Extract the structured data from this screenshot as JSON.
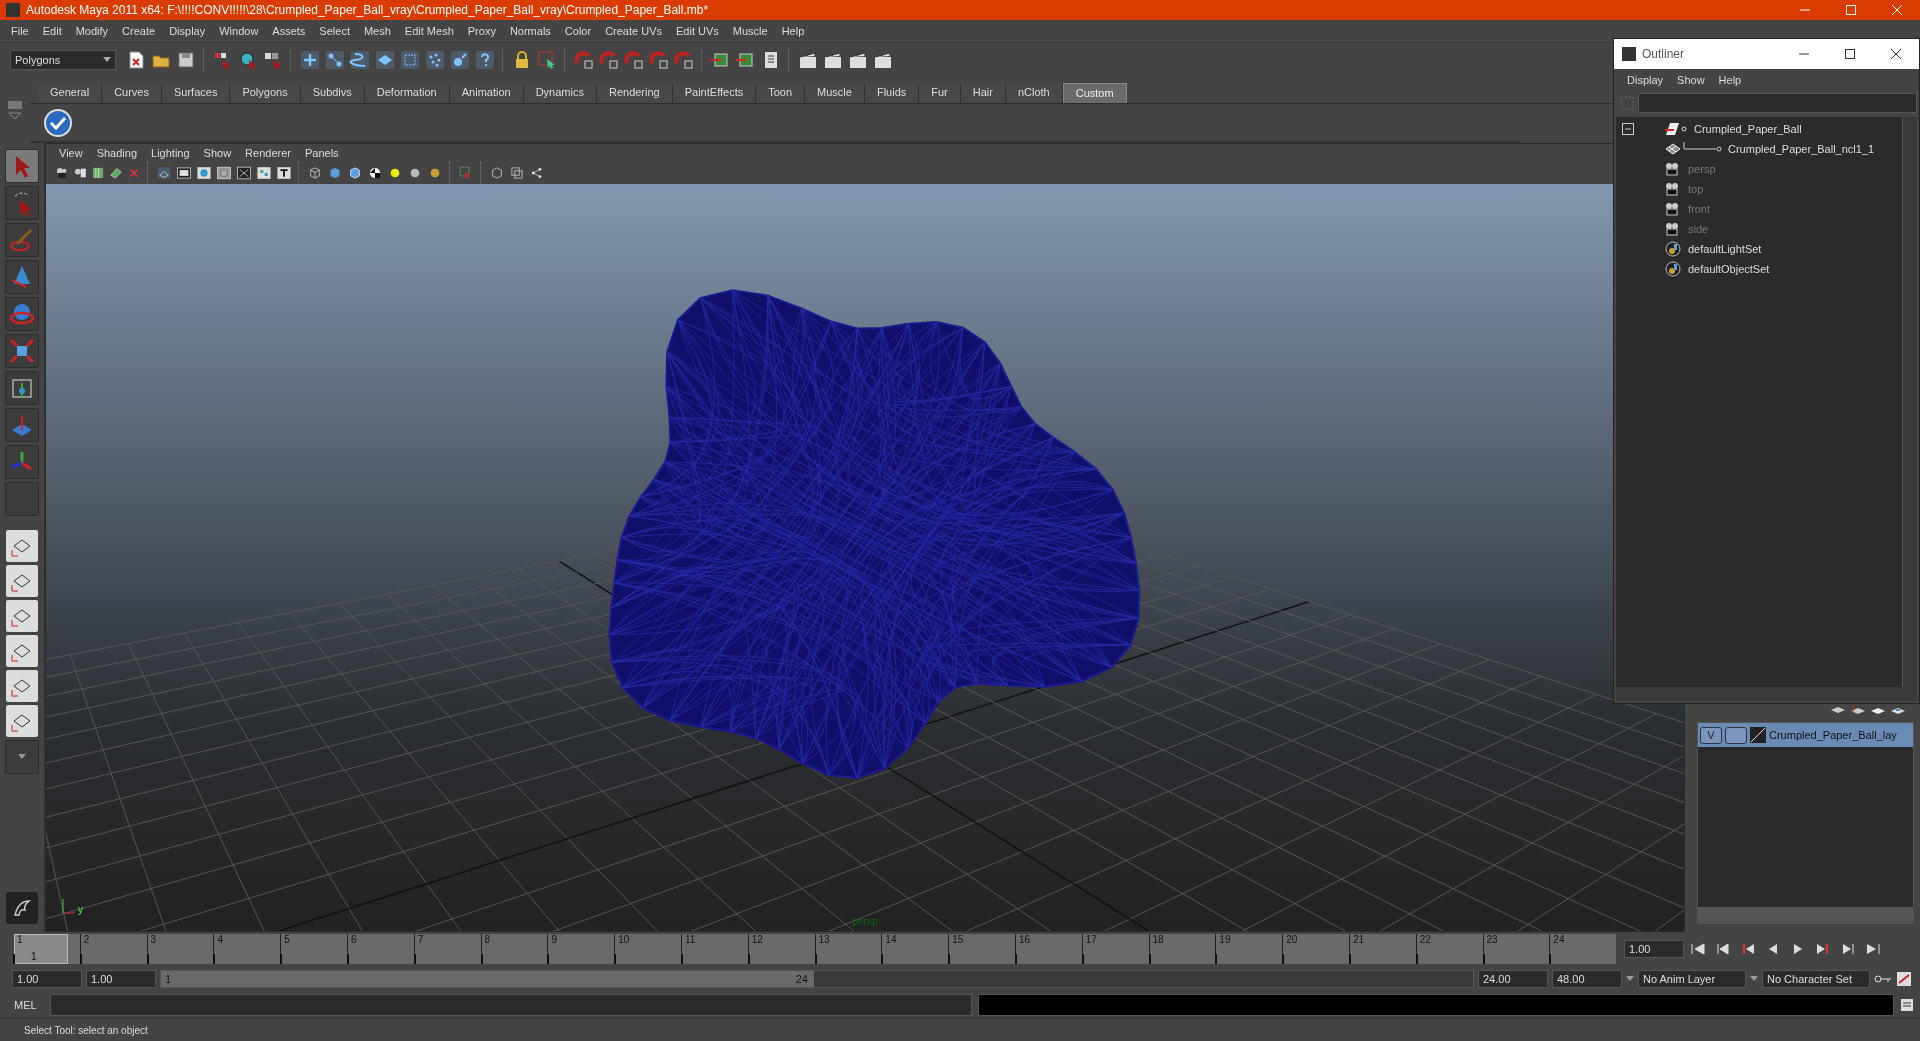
{
  "window": {
    "title": "Autodesk Maya 2011 x64: F:\\!!!!CONV!!!!!\\28\\Crumpled_Paper_Ball_vray\\Crumpled_Paper_Ball_vray\\Crumpled_Paper_Ball.mb*"
  },
  "menu_bar": [
    "File",
    "Edit",
    "Modify",
    "Create",
    "Display",
    "Window",
    "Assets",
    "Select",
    "Mesh",
    "Edit Mesh",
    "Proxy",
    "Normals",
    "Color",
    "Create UVs",
    "Edit UVs",
    "Muscle",
    "Help"
  ],
  "toolbar": {
    "mode_dropdown": "Polygons"
  },
  "shelf": {
    "tabs": [
      {
        "label": "General",
        "selected": false
      },
      {
        "label": "Curves",
        "selected": false
      },
      {
        "label": "Surfaces",
        "selected": false
      },
      {
        "label": "Polygons",
        "selected": false
      },
      {
        "label": "Subdivs",
        "selected": false
      },
      {
        "label": "Deformation",
        "selected": false
      },
      {
        "label": "Animation",
        "selected": false
      },
      {
        "label": "Dynamics",
        "selected": false
      },
      {
        "label": "Rendering",
        "selected": false
      },
      {
        "label": "PaintEffects",
        "selected": false
      },
      {
        "label": "Toon",
        "selected": false
      },
      {
        "label": "Muscle",
        "selected": false
      },
      {
        "label": "Fluids",
        "selected": false
      },
      {
        "label": "Fur",
        "selected": false
      },
      {
        "label": "Hair",
        "selected": false
      },
      {
        "label": "nCloth",
        "selected": false
      },
      {
        "label": "Custom",
        "selected": true
      }
    ]
  },
  "viewport": {
    "menu": [
      "View",
      "Shading",
      "Lighting",
      "Show",
      "Renderer",
      "Panels"
    ],
    "camera_label": "persp",
    "axis_label": "y"
  },
  "outliner": {
    "title": "Outliner",
    "menu": [
      "Display",
      "Show",
      "Help"
    ],
    "items": [
      {
        "label": "Crumpled_Paper_Ball",
        "kind": "transform",
        "dimmed": false,
        "expanded": true,
        "children": [
          {
            "label": "Crumpled_Paper_Ball_ncl1_1",
            "kind": "mesh",
            "dimmed": false
          }
        ]
      },
      {
        "label": "persp",
        "kind": "camera",
        "dimmed": true
      },
      {
        "label": "top",
        "kind": "camera",
        "dimmed": true
      },
      {
        "label": "front",
        "kind": "camera",
        "dimmed": true
      },
      {
        "label": "side",
        "kind": "camera",
        "dimmed": true
      },
      {
        "label": "defaultLightSet",
        "kind": "set",
        "dimmed": false
      },
      {
        "label": "defaultObjectSet",
        "kind": "set",
        "dimmed": false
      }
    ]
  },
  "layers": [
    {
      "visibility": "V",
      "name": "Crumpled_Paper_Ball_lay",
      "selected": true
    }
  ],
  "timeline": {
    "ticks": [
      "1",
      "2",
      "3",
      "4",
      "5",
      "6",
      "7",
      "8",
      "9",
      "10",
      "11",
      "12",
      "13",
      "14",
      "15",
      "16",
      "17",
      "18",
      "19",
      "20",
      "21",
      "22",
      "23",
      "24"
    ],
    "current_frame": "1",
    "level": 0,
    "frame_field": "1.00"
  },
  "range": {
    "start": "1.00",
    "playback_start": "1.00",
    "slider_start": "1",
    "slider_end": "24",
    "level": 0.49,
    "playback_end": "24.00",
    "end": "48.00",
    "anim_layer": "No Anim Layer",
    "character_set": "No Character Set"
  },
  "command_line": {
    "label": "MEL"
  },
  "help_line": "Select Tool: select an object"
}
